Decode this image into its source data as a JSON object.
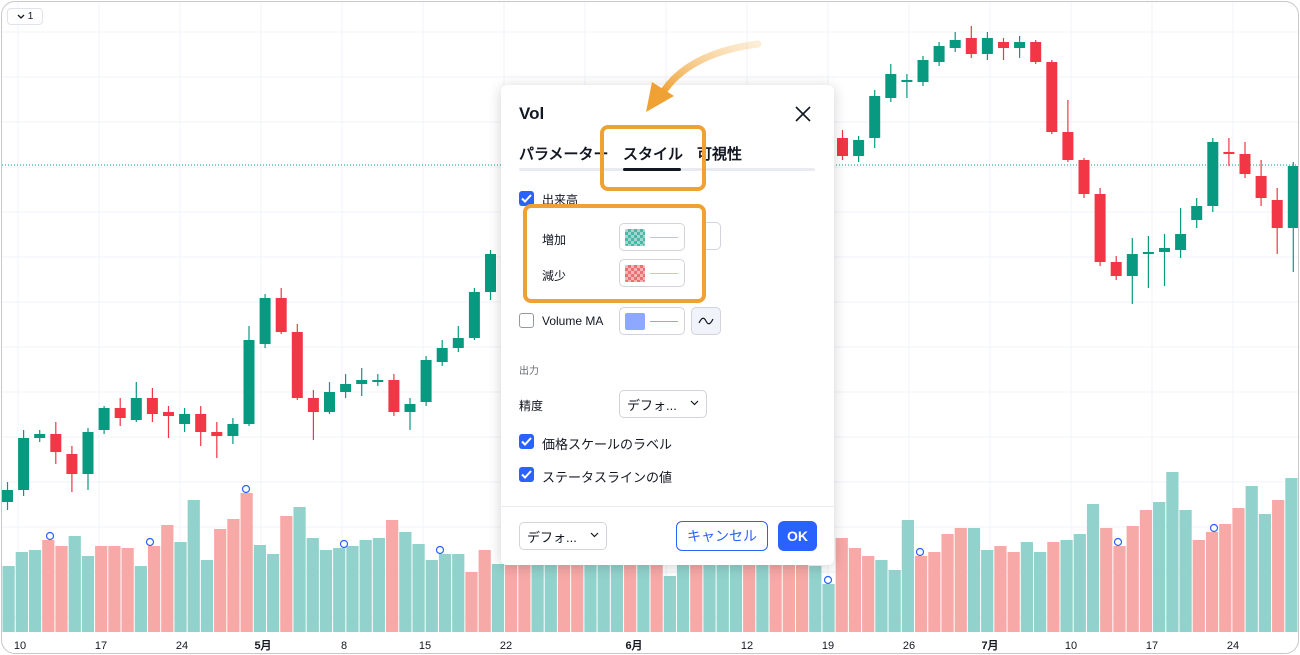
{
  "pane_toggle": {
    "label": "1"
  },
  "chart": {
    "x_axis_labels": [
      {
        "text": "10",
        "bold": false
      },
      {
        "text": "17",
        "bold": false
      },
      {
        "text": "24",
        "bold": false
      },
      {
        "text": "5月",
        "bold": true
      },
      {
        "text": "8",
        "bold": false
      },
      {
        "text": "15",
        "bold": false
      },
      {
        "text": "22",
        "bold": false
      },
      {
        "text": "6月",
        "bold": true
      },
      {
        "text": "12",
        "bold": false
      },
      {
        "text": "19",
        "bold": false
      },
      {
        "text": "26",
        "bold": false
      },
      {
        "text": "7月",
        "bold": true
      },
      {
        "text": "10",
        "bold": false
      },
      {
        "text": "17",
        "bold": false
      },
      {
        "text": "24",
        "bold": false
      }
    ],
    "colors": {
      "up": "#089981",
      "down": "#f23645",
      "volume_up": "#92d2cc",
      "volume_down": "#f7a9a7",
      "grid": "#f0f3fa",
      "price_line": "#089981"
    }
  },
  "dialog": {
    "title": "Vol",
    "tabs": [
      {
        "label": "パラメーター",
        "active": false
      },
      {
        "label": "スタイル",
        "active": true
      },
      {
        "label": "可視性",
        "active": false
      }
    ],
    "inputs": {
      "volume_label": "出来高",
      "volume_checked": true,
      "growing_label": "増加",
      "growing_color": "#22ab94",
      "falling_label": "減少",
      "falling_color": "#f7525f",
      "volume_ma_label": "Volume MA",
      "volume_ma_checked": false,
      "volume_ma_color": "#2962ff"
    },
    "output_section": {
      "heading": "出力",
      "precision_label": "精度",
      "precision_value": "デフォ...",
      "price_scale_label": "価格スケールのラベル",
      "price_scale_checked": true,
      "status_line_label": "ステータスラインの値",
      "status_line_checked": true
    },
    "footer": {
      "defaults_value": "デフォ...",
      "cancel_label": "キャンセル",
      "ok_label": "OK"
    }
  },
  "annotation": {
    "highlight_color": "#f0a133"
  }
}
